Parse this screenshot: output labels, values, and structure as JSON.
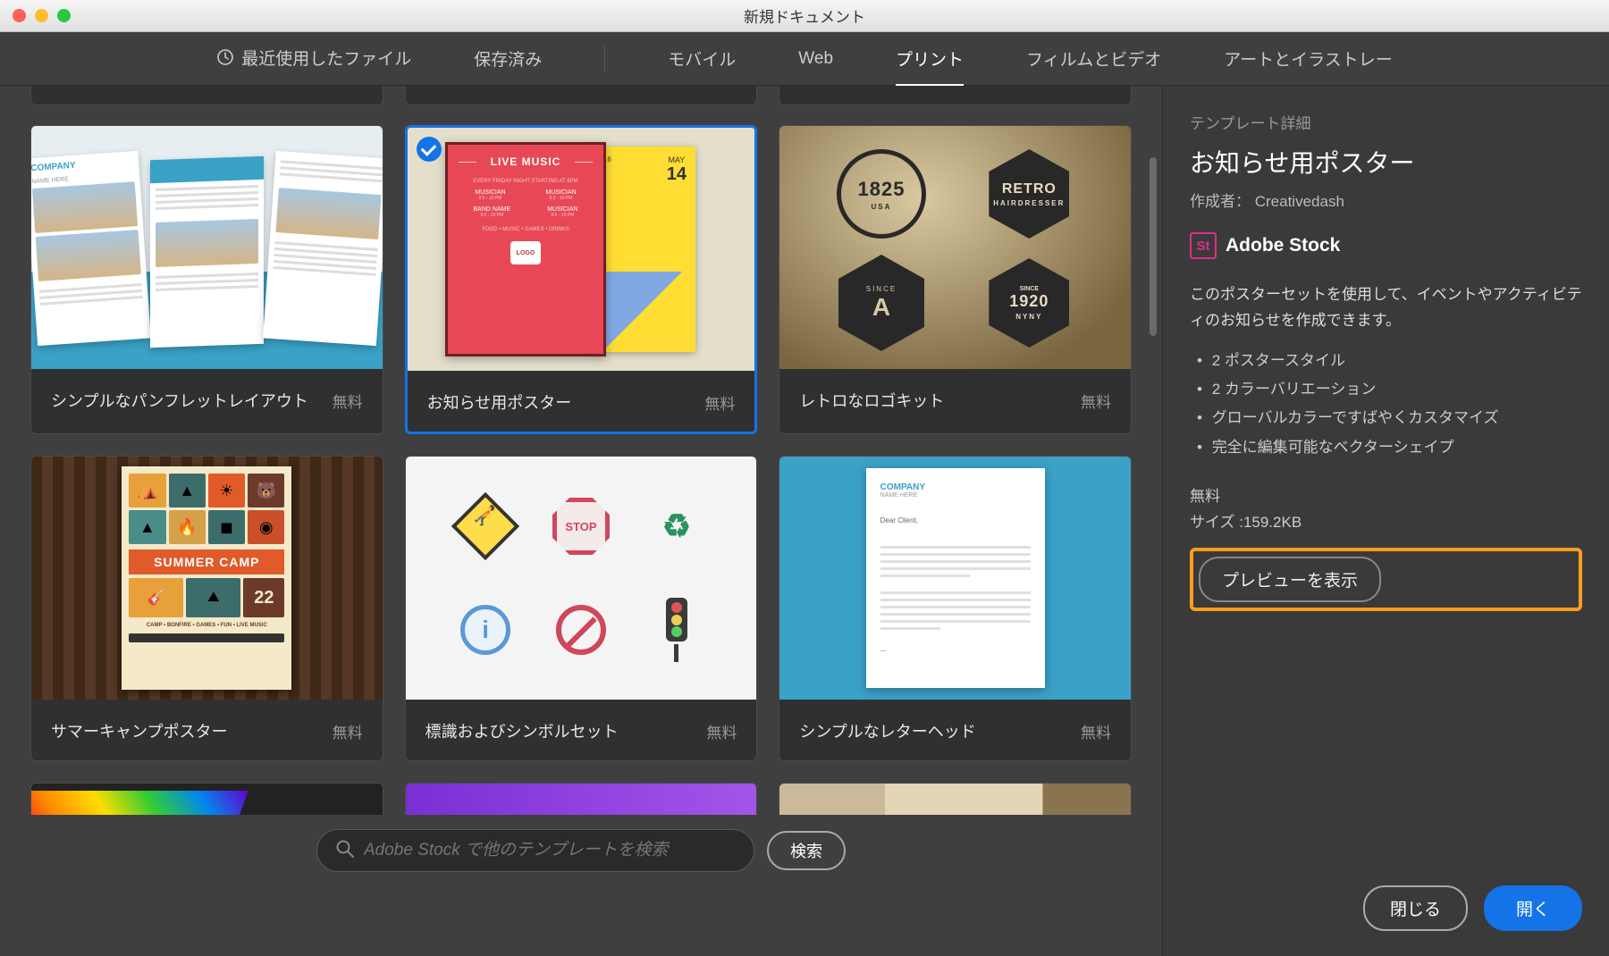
{
  "window": {
    "title": "新規ドキュメント"
  },
  "tabs": {
    "recent": "最近使用したファイル",
    "saved": "保存済み",
    "mobile": "モバイル",
    "web": "Web",
    "print": "プリント",
    "film": "フィルムとビデオ",
    "art": "アートとイラストレー"
  },
  "templates": [
    {
      "title": "シンプルなパンフレットレイアウト",
      "price": "無料"
    },
    {
      "title": "お知らせ用ポスター",
      "price": "無料"
    },
    {
      "title": "レトロなロゴキット",
      "price": "無料"
    },
    {
      "title": "サマーキャンプポスター",
      "price": "無料"
    },
    {
      "title": "標識およびシンボルセット",
      "price": "無料"
    },
    {
      "title": "シンプルなレターヘッド",
      "price": "無料"
    }
  ],
  "detail": {
    "section_label": "テンプレート詳細",
    "title": "お知らせ用ポスター",
    "author_label": "作成者：",
    "author": "Creativedash",
    "stock_abbr": "St",
    "stock_label": "Adobe Stock",
    "description": "このポスターセットを使用して、イベントやアクティビティのお知らせを作成できます。",
    "bullets": [
      "2 ポスタースタイル",
      "2 カラーバリエーション",
      "グローバルカラーですばやくカスタマイズ",
      "完全に編集可能なベクターシェイプ"
    ],
    "price": "無料",
    "size_label": "サイズ :",
    "size": "159.2KB",
    "preview_btn": "プレビューを表示"
  },
  "search": {
    "placeholder": "Adobe Stock で他のテンプレートを検索",
    "button": "検索"
  },
  "buttons": {
    "close": "閉じる",
    "open": "開く"
  },
  "thumb_text": {
    "company": "COMPANY",
    "name_here": "NAME HERE",
    "live_music": "LIVE MUSIC",
    "every_friday": "EVERY FRIDAY NIGHT STARTING AT 6PM",
    "musician": "MUSICIAN",
    "band_name": "BAND NAME",
    "food_line": "FOOD • MUSIC • GAMES • DRINKS",
    "logo": "LOGO",
    "may": "MAY",
    "year2016": "2016",
    "day14": "14",
    "b1825": "1825",
    "usa": "USA",
    "retro": "RETRO",
    "hairdresser": "HAIRDRESSER",
    "a": "A",
    "since": "SINCE",
    "y1920": "1920",
    "nyny": "NYNY",
    "summer_camp": "SUMMER CAMP",
    "n22": "22",
    "stop": "STOP",
    "info_i": "i",
    "dear": "Dear Client,",
    "camp_sub": "CAMP • BONFIRE • GAMES • FUN • LIVE MUSIC"
  }
}
